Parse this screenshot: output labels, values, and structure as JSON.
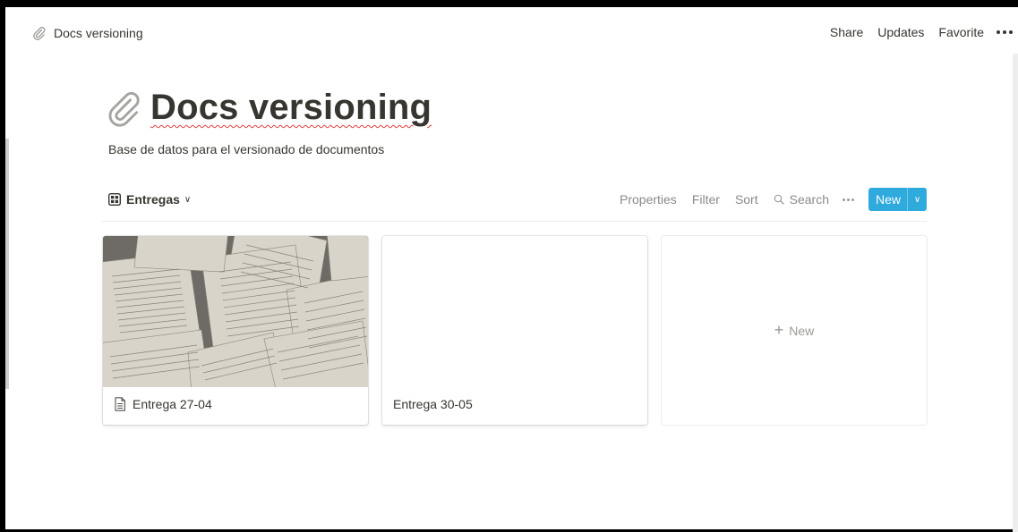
{
  "topbar": {
    "breadcrumb_title": "Docs versioning",
    "breadcrumb_icon": "paperclip-icon",
    "actions": [
      "Share",
      "Updates",
      "Favorite"
    ],
    "more_icon": "more-dots-icon"
  },
  "page": {
    "icon": "paperclip-icon",
    "title": "Docs versioning",
    "description": "Base de datos para el versionado de documentos"
  },
  "view": {
    "name": "Entregas",
    "icon": "gallery-icon",
    "actions": {
      "properties": "Properties",
      "filter": "Filter",
      "sort": "Sort",
      "search": "Search"
    },
    "new_button": "New",
    "accent_color": "#2eaadc"
  },
  "cards": [
    {
      "title": "Entrega 27-04",
      "has_cover": true,
      "icon": "document-icon"
    },
    {
      "title": "Entrega 30-05",
      "has_cover": false
    }
  ],
  "add_card": {
    "label": "New"
  }
}
